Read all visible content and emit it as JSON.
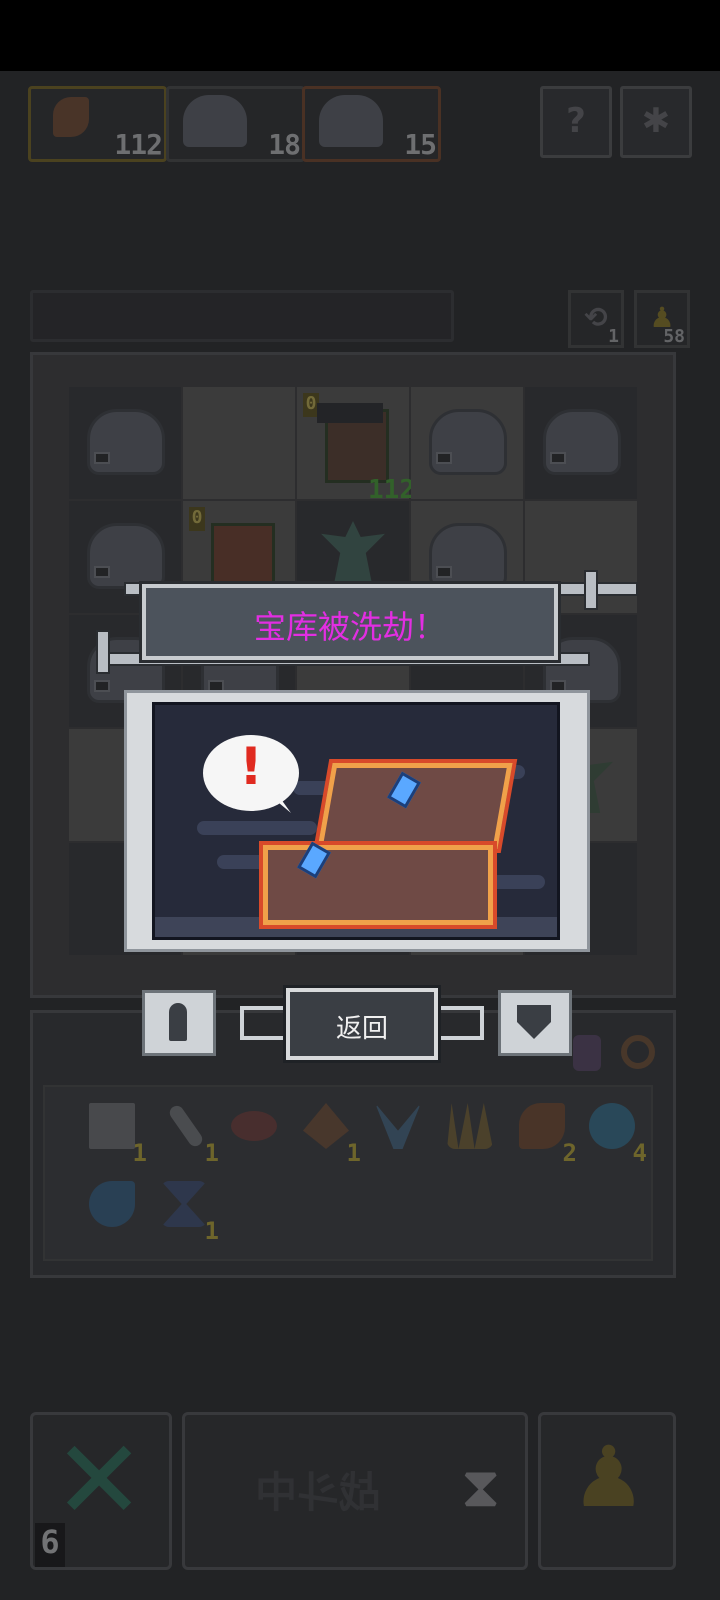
{
  "header": {
    "resources": [
      {
        "icon": "axe-icon",
        "value": "112"
      },
      {
        "icon": "creature-icon",
        "value": "18"
      },
      {
        "icon": "creature-icon",
        "value": "15"
      }
    ],
    "help_icon": "help-icon",
    "settings_icon": "gear-icon"
  },
  "counters": {
    "refresh": {
      "icon": "refresh-icon",
      "value": "1"
    },
    "keys": {
      "icon": "key-icon",
      "value": "58"
    }
  },
  "board": {
    "hero_level": "0",
    "hero_power": "112",
    "unit_level": "0"
  },
  "inventory": {
    "items": [
      {
        "icon": "scroll-icon",
        "count": "1"
      },
      {
        "icon": "bone-icon",
        "count": "1"
      },
      {
        "icon": "crab-icon",
        "count": ""
      },
      {
        "icon": "drill-icon",
        "count": "1"
      },
      {
        "icon": "wing-icon",
        "count": ""
      },
      {
        "icon": "spikes-icon",
        "count": ""
      },
      {
        "icon": "axe-icon",
        "count": "2"
      },
      {
        "icon": "orb-icon",
        "count": "4"
      },
      {
        "icon": "fish-icon",
        "count": ""
      },
      {
        "icon": "hourglass-icon",
        "count": "1"
      }
    ]
  },
  "bottom": {
    "close_count": "6",
    "fight_label": "战斗中"
  },
  "dialog": {
    "title": "宝库被洗劫！",
    "exclaim": "!",
    "back_label": "返回"
  },
  "colors": {
    "title": "#e22ee2",
    "chest_outline": "#d84a2a",
    "chest_gold": "#f0a14a"
  }
}
